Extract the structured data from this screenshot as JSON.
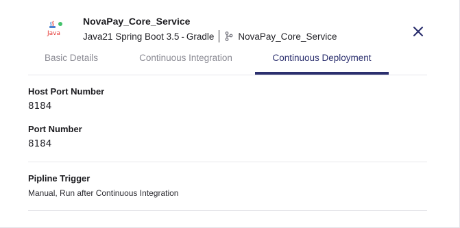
{
  "app": {
    "logo_label": "Java",
    "name": "NovaPay_Core_Service",
    "stack": "Java21 Spring Boot 3.5",
    "build_tool": "Gradle",
    "stack_separator": "-",
    "repo": "NovaPay_Core_Service"
  },
  "tabs": [
    {
      "label": "Basic Details",
      "active": false
    },
    {
      "label": "Continuous Integration",
      "active": false
    },
    {
      "label": "Continuous Deployment",
      "active": true
    }
  ],
  "deployment": {
    "host_port": {
      "label": "Host Port Number",
      "value": "8184"
    },
    "port": {
      "label": "Port Number",
      "value": "8184"
    },
    "trigger": {
      "label": "Pipline Trigger",
      "value": "Manual, Run after Continuous Integration"
    }
  },
  "colors": {
    "accent": "#2b2f6e",
    "status_dot": "#43c26b",
    "java_logo": "#e53935"
  },
  "icons": {
    "logo": "java-logo-icon",
    "branch": "git-branch-icon",
    "close": "close-icon"
  }
}
